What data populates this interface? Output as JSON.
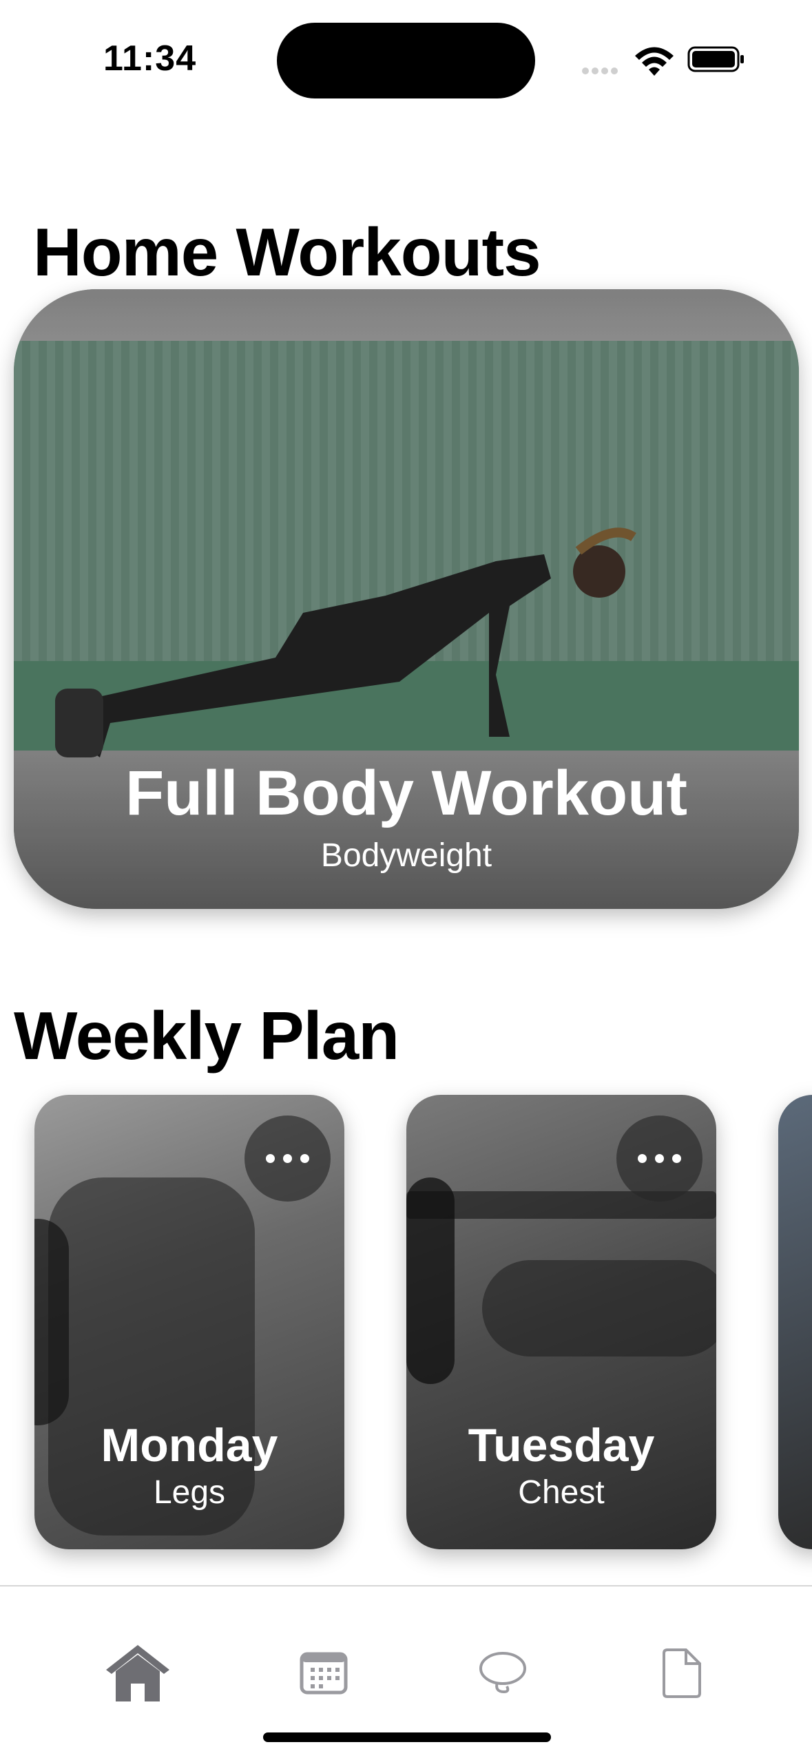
{
  "status_bar": {
    "time": "11:34"
  },
  "home": {
    "title": "Home Workouts"
  },
  "featured": {
    "title": "Full Body Workout",
    "subtitle": "Bodyweight"
  },
  "weekly": {
    "title": "Weekly Plan",
    "days": [
      {
        "day": "Monday",
        "focus": "Legs"
      },
      {
        "day": "Tuesday",
        "focus": "Chest"
      }
    ]
  },
  "tab_bar": {
    "items": [
      {
        "icon": "home-icon",
        "selected": true
      },
      {
        "icon": "calendar-icon",
        "selected": false
      },
      {
        "icon": "chat-bubble-icon",
        "selected": false
      },
      {
        "icon": "document-icon",
        "selected": false
      }
    ]
  },
  "colors": {
    "tab_active": "#6e6e73",
    "tab_inactive": "#9a9a9f"
  }
}
